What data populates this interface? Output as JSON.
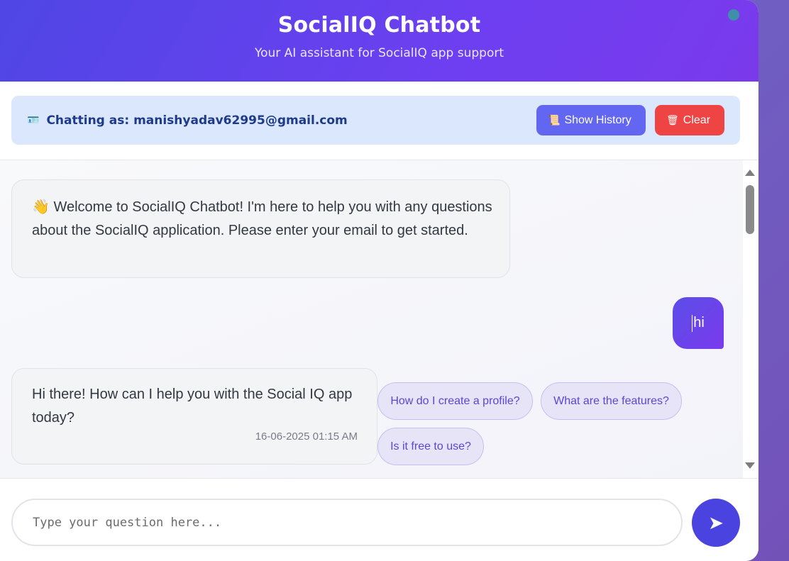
{
  "header": {
    "title": "SocialIQ Chatbot",
    "subtitle": "Your AI assistant for SocialIQ app support"
  },
  "user_bar": {
    "icon": "id-card-icon",
    "chatting_as": "Chatting as: manishyadav62995@gmail.com",
    "history_button": {
      "icon": "scroll-icon",
      "label": "Show History"
    },
    "clear_button": {
      "icon": "trash-icon",
      "label": "Clear"
    }
  },
  "messages": [
    {
      "role": "bot",
      "icon": "👋",
      "text": "Welcome to SocialIQ Chatbot! I'm here to help you with any questions about the SocialIQ application. Please enter your email to get started."
    },
    {
      "role": "user",
      "text": "hi"
    },
    {
      "role": "bot",
      "text": "Hi there! How can I help you with the Social IQ app today?",
      "time": "16-06-2025 01:15 AM"
    }
  ],
  "suggestions": [
    "How do I create a profile?",
    "What are the features?",
    "Is it free to use?"
  ],
  "input": {
    "placeholder": "Type your question here...",
    "value": ""
  },
  "send": {
    "icon": "➤"
  },
  "colors": {
    "header_start": "#4f46e5",
    "header_end": "#7a3aec",
    "history_button": "#6366f1",
    "clear_button": "#ef4444",
    "user_bar_bg": "#dbe7fd",
    "send_button": "#4a43df"
  }
}
